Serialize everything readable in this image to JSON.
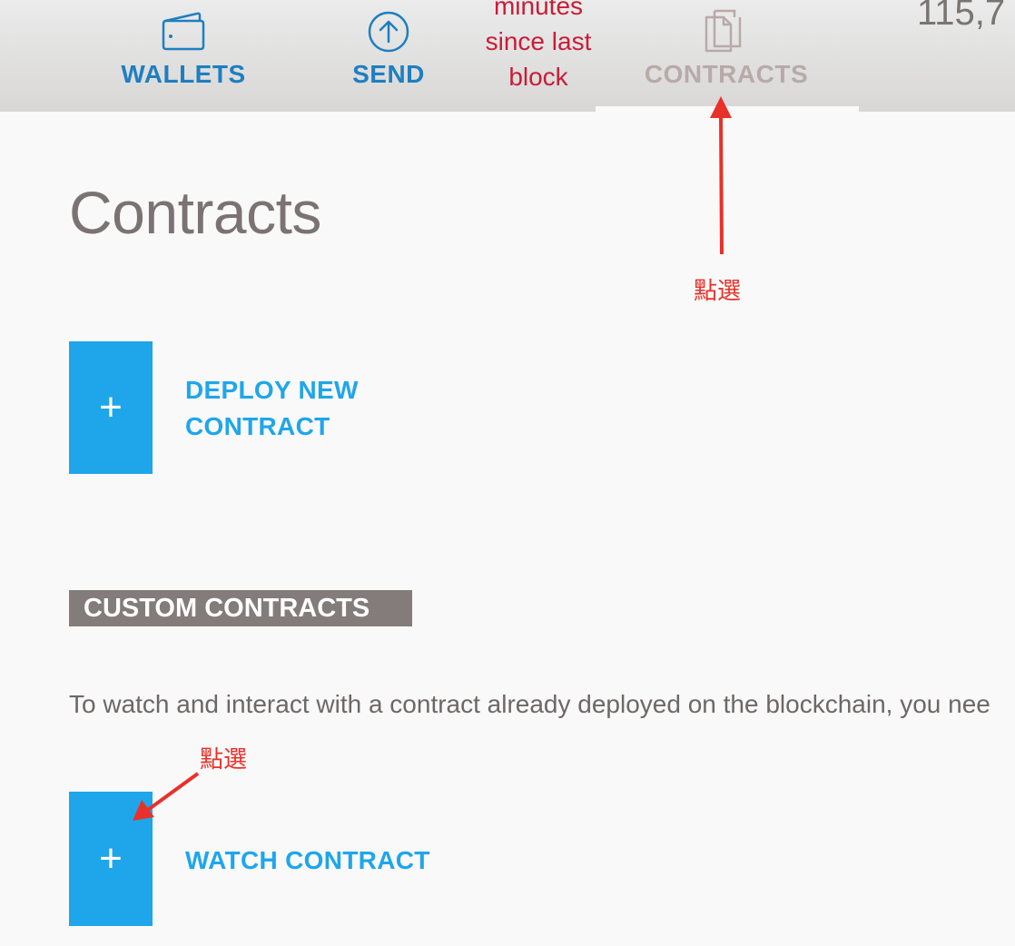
{
  "nav": {
    "wallets": {
      "label": "WALLETS",
      "icon": "wallet-icon"
    },
    "send": {
      "label": "SEND",
      "icon": "arrow-up-circle-icon"
    },
    "contracts": {
      "label": "CONTRACTS",
      "icon": "documents-icon"
    }
  },
  "block_info": {
    "line1": "minutes",
    "line2": "since last",
    "line3": "block"
  },
  "balance": {
    "value": "115,7"
  },
  "page": {
    "title": "Contracts"
  },
  "deploy": {
    "plus": "+",
    "label_line1": "DEPLOY NEW",
    "label_line2": "CONTRACT"
  },
  "custom": {
    "header": "CUSTOM CONTRACTS",
    "description": "To watch and interact with a contract already deployed on the blockchain, you nee"
  },
  "watch": {
    "plus": "+",
    "label": "WATCH CONTRACT"
  },
  "annotations": {
    "top": "點選",
    "bottom": "點選"
  },
  "colors": {
    "nav_active": "#1e7fc0",
    "nav_inactive": "#b8aaa8",
    "accent": "#1fa6ea",
    "block_info": "#c81d37",
    "annotation": "#e8312a",
    "section_header_bg": "#837c7b"
  }
}
